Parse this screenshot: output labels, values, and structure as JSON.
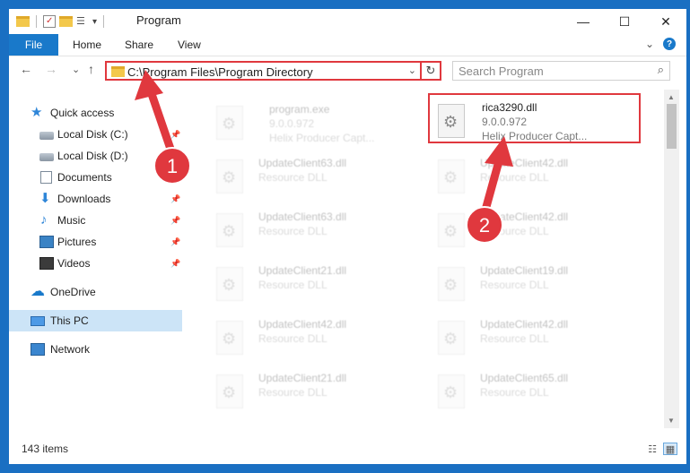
{
  "window": {
    "title": "Program",
    "controls": {
      "minimize": "—",
      "maximize": "☐",
      "close": "✕"
    }
  },
  "quick_access_toolbar": {
    "dropdown": "▾"
  },
  "ribbon": {
    "file_label": "File",
    "tabs": [
      "Home",
      "Share",
      "View"
    ],
    "expand": "⌄",
    "help": "?"
  },
  "navigation": {
    "back": "←",
    "forward": "→",
    "recent": "⌄",
    "up": "↑",
    "address": "C:\\Program Files\\Program Directory",
    "address_dropdown": "⌄",
    "refresh": "↻",
    "search_placeholder": "Search Program",
    "search_icon": "⌕"
  },
  "sidebar": {
    "items": [
      {
        "label": "Quick access",
        "icon": "star-icon",
        "pinned": false
      },
      {
        "label": "Local Disk (C:)",
        "icon": "disk-icon",
        "pinned": true
      },
      {
        "label": "Local Disk (D:)",
        "icon": "disk-icon",
        "pinned": true
      },
      {
        "label": "Documents",
        "icon": "documents-icon",
        "pinned": true
      },
      {
        "label": "Downloads",
        "icon": "downloads-icon",
        "pinned": true
      },
      {
        "label": "Music",
        "icon": "music-icon",
        "pinned": true
      },
      {
        "label": "Pictures",
        "icon": "pictures-icon",
        "pinned": true
      },
      {
        "label": "Videos",
        "icon": "videos-icon",
        "pinned": true
      },
      {
        "label": "OneDrive",
        "icon": "onedrive-icon",
        "pinned": false
      },
      {
        "label": "This PC",
        "icon": "this-pc-icon",
        "pinned": false,
        "selected": true
      },
      {
        "label": "Network",
        "icon": "network-icon",
        "pinned": false
      }
    ],
    "pin_glyph": "📌"
  },
  "files": {
    "highlighted": {
      "name": "rica3290.dll",
      "version": "9.0.0.972",
      "description": "Helix Producer Capt..."
    },
    "faded": [
      {
        "name": "program.exe",
        "line1": "9.0.0.972",
        "line2": "Helix Producer Capt..."
      },
      {
        "name": "UpdateClient63.dll",
        "line1": "Resource DLL"
      },
      {
        "name": "UpdateClient42.dll",
        "line1": "Resource DLL"
      },
      {
        "name": "UpdateClient63.dll",
        "line1": "Resource DLL"
      },
      {
        "name": "UpdateClient42.dll",
        "line1": "Resource DLL"
      },
      {
        "name": "UpdateClient21.dll",
        "line1": "Resource DLL"
      },
      {
        "name": "UpdateClient19.dll",
        "line1": "Resource DLL"
      },
      {
        "name": "UpdateClient42.dll",
        "line1": "Resource DLL"
      },
      {
        "name": "UpdateClient42.dll",
        "line1": "Resource DLL"
      },
      {
        "name": "UpdateClient21.dll",
        "line1": "Resource DLL"
      },
      {
        "name": "UpdateClient65.dll",
        "line1": "Resource DLL"
      }
    ]
  },
  "status": {
    "item_count": "143 items"
  },
  "annotations": {
    "step1": "1",
    "step2": "2",
    "color": "#e0383e"
  },
  "colors": {
    "accent": "#1979ca",
    "selection": "#cce4f7",
    "annotation": "#e0383e"
  }
}
